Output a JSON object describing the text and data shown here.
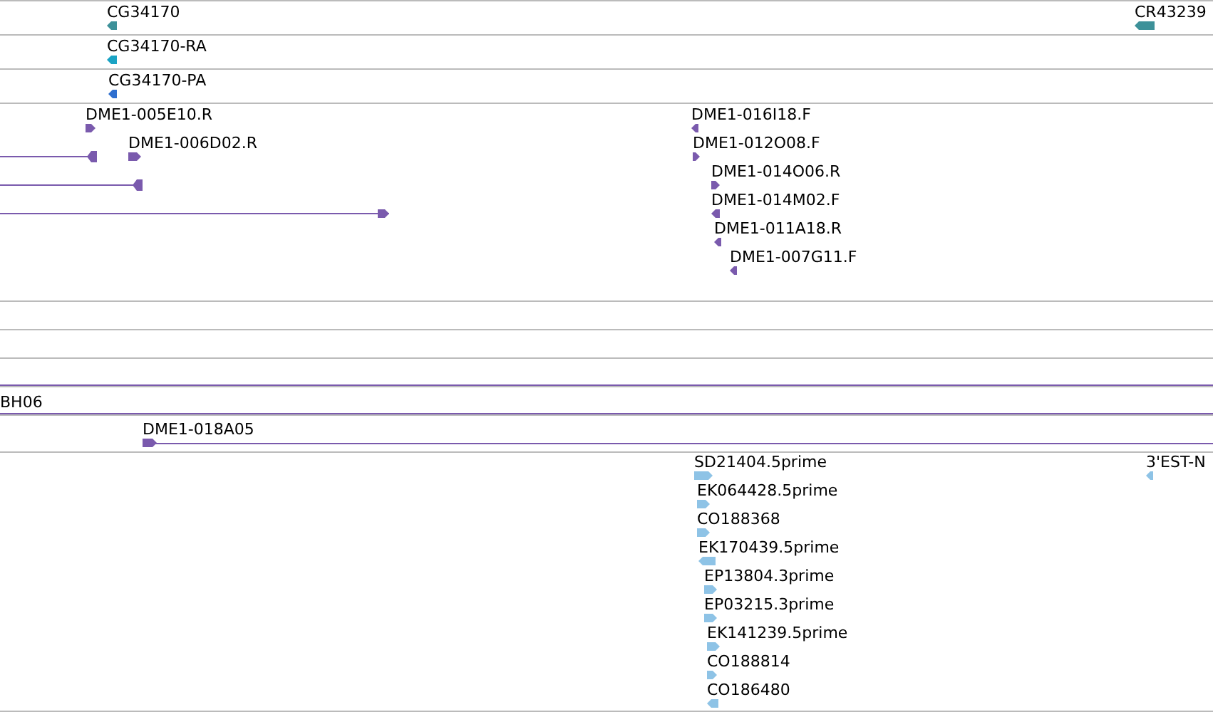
{
  "tracks": [
    {
      "kind": "features",
      "color": "#3d9199",
      "features": [
        {
          "kind": "arrow",
          "label": "CG34170",
          "reverse": true
        },
        {
          "kind": "arrow",
          "label": "CR43239",
          "reverse": true
        }
      ]
    },
    {
      "kind": "features",
      "color": "#1aa3c4",
      "features": [
        {
          "kind": "arrow",
          "label": "CG34170-RA",
          "reverse": true
        }
      ]
    },
    {
      "kind": "features",
      "color": "#2f6fcf",
      "features": [
        {
          "kind": "arrow",
          "label": "CG34170-PA",
          "reverse": true
        }
      ]
    },
    {
      "kind": "features",
      "color": "#7a5aad",
      "features": [
        {
          "kind": "arrow",
          "label": "DME1-005E10.R",
          "reverse": false
        },
        {
          "kind": "span",
          "head": true,
          "reverse": true
        },
        {
          "kind": "arrow",
          "label": "DME1-006D02.R",
          "reverse": false
        },
        {
          "kind": "span",
          "head": true,
          "reverse": true
        },
        {
          "kind": "span",
          "head": true,
          "reverse": false
        },
        {
          "kind": "arrow",
          "label": "DME1-016I18.F",
          "reverse": true
        },
        {
          "kind": "arrow",
          "label": "DME1-012O08.F",
          "reverse": false
        },
        {
          "kind": "arrow",
          "label": "DME1-014O06.R",
          "reverse": false
        },
        {
          "kind": "arrow",
          "label": "DME1-014M02.F",
          "reverse": true
        },
        {
          "kind": "arrow",
          "label": "DME1-011A18.R",
          "reverse": true
        },
        {
          "kind": "arrow",
          "label": "DME1-007G11.F",
          "reverse": true
        }
      ]
    },
    {
      "kind": "empty"
    },
    {
      "kind": "empty"
    },
    {
      "kind": "features",
      "color": "#7a5aad",
      "features": [
        {
          "kind": "span",
          "head": false
        }
      ]
    },
    {
      "kind": "features",
      "color": "#7a5aad",
      "features": [
        {
          "kind": "span",
          "head": false,
          "label": "BH06"
        }
      ]
    },
    {
      "kind": "features",
      "color": "#7a5aad",
      "features": [
        {
          "kind": "arrow",
          "label": "DME1-018A05",
          "reverse": false
        },
        {
          "kind": "span",
          "head": false
        }
      ]
    },
    {
      "kind": "features",
      "color": "#8ec3e6",
      "features": [
        {
          "kind": "arrow",
          "label": "SD21404.5prime",
          "reverse": false
        },
        {
          "kind": "arrow",
          "label": "EK064428.5prime",
          "reverse": false
        },
        {
          "kind": "arrow",
          "label": "CO188368",
          "reverse": false
        },
        {
          "kind": "arrow",
          "label": "EK170439.5prime",
          "reverse": true
        },
        {
          "kind": "arrow",
          "label": "EP13804.3prime",
          "reverse": false
        },
        {
          "kind": "arrow",
          "label": "EP03215.3prime",
          "reverse": false
        },
        {
          "kind": "arrow",
          "label": "EK141239.5prime",
          "reverse": false
        },
        {
          "kind": "arrow",
          "label": "CO188814",
          "reverse": false
        },
        {
          "kind": "arrow",
          "label": "CO186480",
          "reverse": true
        },
        {
          "kind": "arrow",
          "label": "3'EST-N",
          "reverse": true
        }
      ]
    }
  ]
}
